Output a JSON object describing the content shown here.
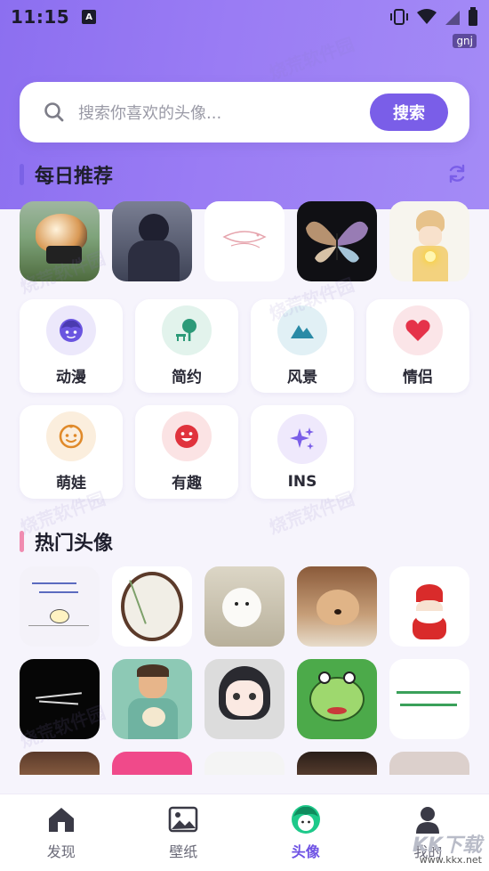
{
  "status_bar": {
    "time": "11:15",
    "badge": "gnj"
  },
  "search": {
    "placeholder": "搜索你喜欢的头像...",
    "button_label": "搜索"
  },
  "daily": {
    "title": "每日推荐"
  },
  "categories": [
    {
      "label": "动漫",
      "icon": "anime-face-icon",
      "color": "#6a55e0",
      "bg": "#ece8fb"
    },
    {
      "label": "简约",
      "icon": "tree-bench-icon",
      "color": "#2c9a78",
      "bg": "#e2f3ec"
    },
    {
      "label": "风景",
      "icon": "mountain-icon",
      "color": "#2a8aa6",
      "bg": "#e1f0f5"
    },
    {
      "label": "情侣",
      "icon": "heart-icon",
      "color": "#e5334a",
      "bg": "#fbe5e8"
    },
    {
      "label": "萌娃",
      "icon": "baby-face-icon",
      "color": "#e08a2a",
      "bg": "#fbeedd"
    },
    {
      "label": "有趣",
      "icon": "smile-icon",
      "color": "#e0333d",
      "bg": "#fbe3e4"
    },
    {
      "label": "INS",
      "icon": "sparkle-icon",
      "color": "#7a5ee8",
      "bg": "#efe9fc"
    }
  ],
  "hot": {
    "title": "热门头像"
  },
  "nav": [
    {
      "label": "发现",
      "icon": "home-icon",
      "active": false
    },
    {
      "label": "壁纸",
      "icon": "picture-icon",
      "active": false
    },
    {
      "label": "头像",
      "icon": "avatar-face-icon",
      "active": true
    },
    {
      "label": "我的",
      "icon": "person-icon",
      "active": false
    }
  ],
  "watermark": {
    "text": "烧荒软件园",
    "corner_logo": "KK下载",
    "corner_url": "www.kkx.net"
  },
  "colors": {
    "accent": "#7a5ee8",
    "daily_bar": "#7b62e6",
    "hot_bar": "#f08bb0"
  }
}
